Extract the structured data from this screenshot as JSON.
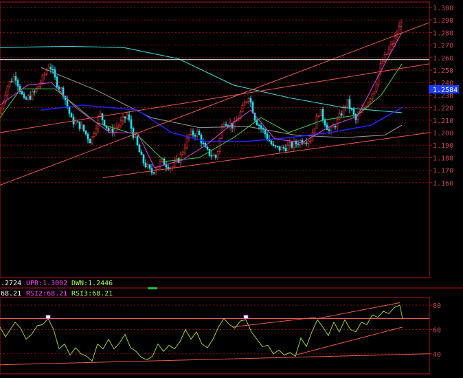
{
  "colors": {
    "background": "#000000",
    "frame": "#b01818",
    "grid": "#9a1010",
    "axis_text": "#c84848",
    "candle_up": "#e03030",
    "candle_down": "#20e0f0",
    "trendline": "#f05a4a",
    "price_line": "#ffffff",
    "price_tag_bg": "#1a3cff",
    "price_tag_text": "#ffffff",
    "ma_cyan": "#40d0d0",
    "ma_blue": "#2020ff",
    "ma_green": "#40c040",
    "ma_magenta": "#d040d0",
    "ma_gray": "#909090",
    "rsi1": "#ffffff",
    "rsi2": "#ff40ff",
    "rsi3": "#a0ff60",
    "rsi_line": "#a0d040"
  },
  "price_panel": {
    "current_price_tag": "1.2584",
    "indicator_bar": {
      "mid_label": ".2724",
      "upr_label": "UPR:1.3002",
      "dwn_label": "DWN:1.2446"
    }
  },
  "rsi_panel": {
    "rsi1_label": "68.21",
    "rsi2_label": "RSI2:68.21",
    "rsi3_label": "RSI3:68.21"
  },
  "chart_data": [
    {
      "type": "candlestick",
      "y_ticks": [
        "1.300",
        "1.290",
        "1.280",
        "1.270",
        "1.260",
        "1.250",
        "1.240",
        "1.230",
        "1.220",
        "1.210",
        "1.200",
        "1.190",
        "1.180",
        "1.170",
        "1.160"
      ],
      "ylim": [
        1.158,
        1.302
      ],
      "current_price": 1.2584,
      "grid": true,
      "approx_close_path": [
        {
          "x": 0,
          "y": 1.215
        },
        {
          "x": 10,
          "y": 1.237
        },
        {
          "x": 22,
          "y": 1.246
        },
        {
          "x": 35,
          "y": 1.225
        },
        {
          "x": 50,
          "y": 1.232
        },
        {
          "x": 62,
          "y": 1.243
        },
        {
          "x": 72,
          "y": 1.255
        },
        {
          "x": 82,
          "y": 1.24
        },
        {
          "x": 92,
          "y": 1.232
        },
        {
          "x": 104,
          "y": 1.21
        },
        {
          "x": 118,
          "y": 1.205
        },
        {
          "x": 132,
          "y": 1.193
        },
        {
          "x": 145,
          "y": 1.215
        },
        {
          "x": 160,
          "y": 1.2
        },
        {
          "x": 175,
          "y": 1.207
        },
        {
          "x": 185,
          "y": 1.214
        },
        {
          "x": 195,
          "y": 1.197
        },
        {
          "x": 207,
          "y": 1.178
        },
        {
          "x": 220,
          "y": 1.168
        },
        {
          "x": 235,
          "y": 1.177
        },
        {
          "x": 250,
          "y": 1.172
        },
        {
          "x": 262,
          "y": 1.18
        },
        {
          "x": 275,
          "y": 1.198
        },
        {
          "x": 288,
          "y": 1.2
        },
        {
          "x": 300,
          "y": 1.185
        },
        {
          "x": 315,
          "y": 1.18
        },
        {
          "x": 325,
          "y": 1.21
        },
        {
          "x": 340,
          "y": 1.205
        },
        {
          "x": 352,
          "y": 1.218
        },
        {
          "x": 362,
          "y": 1.23
        },
        {
          "x": 372,
          "y": 1.21
        },
        {
          "x": 385,
          "y": 1.2
        },
        {
          "x": 398,
          "y": 1.188
        },
        {
          "x": 410,
          "y": 1.187
        },
        {
          "x": 425,
          "y": 1.19
        },
        {
          "x": 440,
          "y": 1.194
        },
        {
          "x": 452,
          "y": 1.195
        },
        {
          "x": 465,
          "y": 1.218
        },
        {
          "x": 480,
          "y": 1.2
        },
        {
          "x": 492,
          "y": 1.21
        },
        {
          "x": 505,
          "y": 1.225
        },
        {
          "x": 518,
          "y": 1.21
        },
        {
          "x": 530,
          "y": 1.22
        },
        {
          "x": 545,
          "y": 1.235
        },
        {
          "x": 555,
          "y": 1.255
        },
        {
          "x": 565,
          "y": 1.265
        },
        {
          "x": 575,
          "y": 1.275
        },
        {
          "x": 582,
          "y": 1.285
        },
        {
          "x": 586,
          "y": 1.296
        }
      ],
      "moving_averages": [
        {
          "color_key": "ma_cyan",
          "points": [
            {
              "x": 0,
              "y": 1.268
            },
            {
              "x": 100,
              "y": 1.269
            },
            {
              "x": 180,
              "y": 1.268
            },
            {
              "x": 260,
              "y": 1.259
            },
            {
              "x": 340,
              "y": 1.238
            },
            {
              "x": 420,
              "y": 1.228
            },
            {
              "x": 500,
              "y": 1.22
            },
            {
              "x": 585,
              "y": 1.216
            }
          ]
        },
        {
          "color_key": "ma_gray",
          "points": [
            {
              "x": 60,
              "y": 1.252
            },
            {
              "x": 140,
              "y": 1.234
            },
            {
              "x": 220,
              "y": 1.212
            },
            {
              "x": 290,
              "y": 1.204
            },
            {
              "x": 360,
              "y": 1.205
            },
            {
              "x": 430,
              "y": 1.198
            },
            {
              "x": 500,
              "y": 1.196
            },
            {
              "x": 560,
              "y": 1.198
            },
            {
              "x": 585,
              "y": 1.206
            }
          ]
        },
        {
          "color_key": "ma_blue",
          "points": [
            {
              "x": 60,
              "y": 1.218
            },
            {
              "x": 120,
              "y": 1.222
            },
            {
              "x": 200,
              "y": 1.218
            },
            {
              "x": 250,
              "y": 1.2
            },
            {
              "x": 300,
              "y": 1.193
            },
            {
              "x": 360,
              "y": 1.193
            },
            {
              "x": 420,
              "y": 1.196
            },
            {
              "x": 480,
              "y": 1.2
            },
            {
              "x": 540,
              "y": 1.206
            },
            {
              "x": 585,
              "y": 1.22
            }
          ]
        },
        {
          "color_key": "ma_green",
          "points": [
            {
              "x": 0,
              "y": 1.212
            },
            {
              "x": 30,
              "y": 1.235
            },
            {
              "x": 80,
              "y": 1.235
            },
            {
              "x": 140,
              "y": 1.208
            },
            {
              "x": 200,
              "y": 1.198
            },
            {
              "x": 240,
              "y": 1.177
            },
            {
              "x": 290,
              "y": 1.18
            },
            {
              "x": 340,
              "y": 1.196
            },
            {
              "x": 380,
              "y": 1.212
            },
            {
              "x": 420,
              "y": 1.2
            },
            {
              "x": 470,
              "y": 1.21
            },
            {
              "x": 520,
              "y": 1.214
            },
            {
              "x": 555,
              "y": 1.23
            },
            {
              "x": 585,
              "y": 1.255
            }
          ]
        },
        {
          "color_key": "ma_magenta",
          "points": [
            {
              "x": 0,
              "y": 1.222
            },
            {
              "x": 40,
              "y": 1.238
            },
            {
              "x": 75,
              "y": 1.24
            },
            {
              "x": 110,
              "y": 1.22
            },
            {
              "x": 160,
              "y": 1.2
            },
            {
              "x": 200,
              "y": 1.2
            },
            {
              "x": 225,
              "y": 1.172
            },
            {
              "x": 265,
              "y": 1.178
            },
            {
              "x": 300,
              "y": 1.19
            },
            {
              "x": 340,
              "y": 1.208
            },
            {
              "x": 365,
              "y": 1.218
            },
            {
              "x": 400,
              "y": 1.195
            },
            {
              "x": 440,
              "y": 1.192
            },
            {
              "x": 480,
              "y": 1.205
            },
            {
              "x": 520,
              "y": 1.213
            },
            {
              "x": 560,
              "y": 1.255
            },
            {
              "x": 585,
              "y": 1.28
            }
          ]
        }
      ],
      "trendlines": [
        {
          "x1": 0,
          "y1": 1.2,
          "x2": 625,
          "y2": 1.255
        },
        {
          "x1": 0,
          "y1": 1.158,
          "x2": 625,
          "y2": 1.288
        },
        {
          "x1": 150,
          "y1": 1.164,
          "x2": 625,
          "y2": 1.2
        }
      ]
    },
    {
      "type": "line",
      "name": "RSI",
      "y_ticks": [
        "80",
        "60",
        "40"
      ],
      "ylim": [
        28,
        90
      ],
      "grid": true,
      "values": [
        {
          "x": 0,
          "y": 62
        },
        {
          "x": 8,
          "y": 54
        },
        {
          "x": 15,
          "y": 60
        },
        {
          "x": 22,
          "y": 66
        },
        {
          "x": 30,
          "y": 61
        },
        {
          "x": 38,
          "y": 52
        },
        {
          "x": 46,
          "y": 56
        },
        {
          "x": 54,
          "y": 63
        },
        {
          "x": 62,
          "y": 64
        },
        {
          "x": 70,
          "y": 69
        },
        {
          "x": 78,
          "y": 60
        },
        {
          "x": 86,
          "y": 44
        },
        {
          "x": 94,
          "y": 48
        },
        {
          "x": 102,
          "y": 39
        },
        {
          "x": 110,
          "y": 45
        },
        {
          "x": 118,
          "y": 40
        },
        {
          "x": 126,
          "y": 38
        },
        {
          "x": 134,
          "y": 34
        },
        {
          "x": 142,
          "y": 48
        },
        {
          "x": 150,
          "y": 44
        },
        {
          "x": 158,
          "y": 52
        },
        {
          "x": 166,
          "y": 44
        },
        {
          "x": 174,
          "y": 49
        },
        {
          "x": 182,
          "y": 56
        },
        {
          "x": 190,
          "y": 45
        },
        {
          "x": 198,
          "y": 42
        },
        {
          "x": 206,
          "y": 37
        },
        {
          "x": 214,
          "y": 35
        },
        {
          "x": 222,
          "y": 38
        },
        {
          "x": 230,
          "y": 48
        },
        {
          "x": 238,
          "y": 42
        },
        {
          "x": 246,
          "y": 47
        },
        {
          "x": 254,
          "y": 44
        },
        {
          "x": 262,
          "y": 50
        },
        {
          "x": 270,
          "y": 60
        },
        {
          "x": 278,
          "y": 52
        },
        {
          "x": 286,
          "y": 58
        },
        {
          "x": 294,
          "y": 48
        },
        {
          "x": 302,
          "y": 45
        },
        {
          "x": 310,
          "y": 52
        },
        {
          "x": 318,
          "y": 62
        },
        {
          "x": 326,
          "y": 69
        },
        {
          "x": 334,
          "y": 64
        },
        {
          "x": 342,
          "y": 61
        },
        {
          "x": 350,
          "y": 67
        },
        {
          "x": 358,
          "y": 68
        },
        {
          "x": 366,
          "y": 58
        },
        {
          "x": 374,
          "y": 52
        },
        {
          "x": 382,
          "y": 46
        },
        {
          "x": 390,
          "y": 47
        },
        {
          "x": 398,
          "y": 40
        },
        {
          "x": 406,
          "y": 43
        },
        {
          "x": 414,
          "y": 39
        },
        {
          "x": 422,
          "y": 41
        },
        {
          "x": 430,
          "y": 38
        },
        {
          "x": 438,
          "y": 53
        },
        {
          "x": 446,
          "y": 46
        },
        {
          "x": 454,
          "y": 58
        },
        {
          "x": 462,
          "y": 68
        },
        {
          "x": 470,
          "y": 62
        },
        {
          "x": 478,
          "y": 55
        },
        {
          "x": 486,
          "y": 66
        },
        {
          "x": 494,
          "y": 58
        },
        {
          "x": 502,
          "y": 68
        },
        {
          "x": 510,
          "y": 60
        },
        {
          "x": 518,
          "y": 58
        },
        {
          "x": 526,
          "y": 66
        },
        {
          "x": 534,
          "y": 64
        },
        {
          "x": 542,
          "y": 72
        },
        {
          "x": 550,
          "y": 70
        },
        {
          "x": 558,
          "y": 75
        },
        {
          "x": 566,
          "y": 73
        },
        {
          "x": 574,
          "y": 78
        },
        {
          "x": 582,
          "y": 80
        },
        {
          "x": 586,
          "y": 69
        }
      ],
      "trendlines": [
        {
          "x1": 0,
          "y1": 31,
          "x2": 625,
          "y2": 40
        },
        {
          "x1": 430,
          "y1": 39,
          "x2": 586,
          "y2": 62
        },
        {
          "x1": 338,
          "y1": 62,
          "x2": 460,
          "y2": 70
        },
        {
          "x1": 462,
          "y1": 69,
          "x2": 582,
          "y2": 82
        }
      ],
      "hlines": [
        69
      ],
      "markers": [
        {
          "x": 70,
          "y": 70
        },
        {
          "x": 358,
          "y": 70
        }
      ]
    }
  ]
}
